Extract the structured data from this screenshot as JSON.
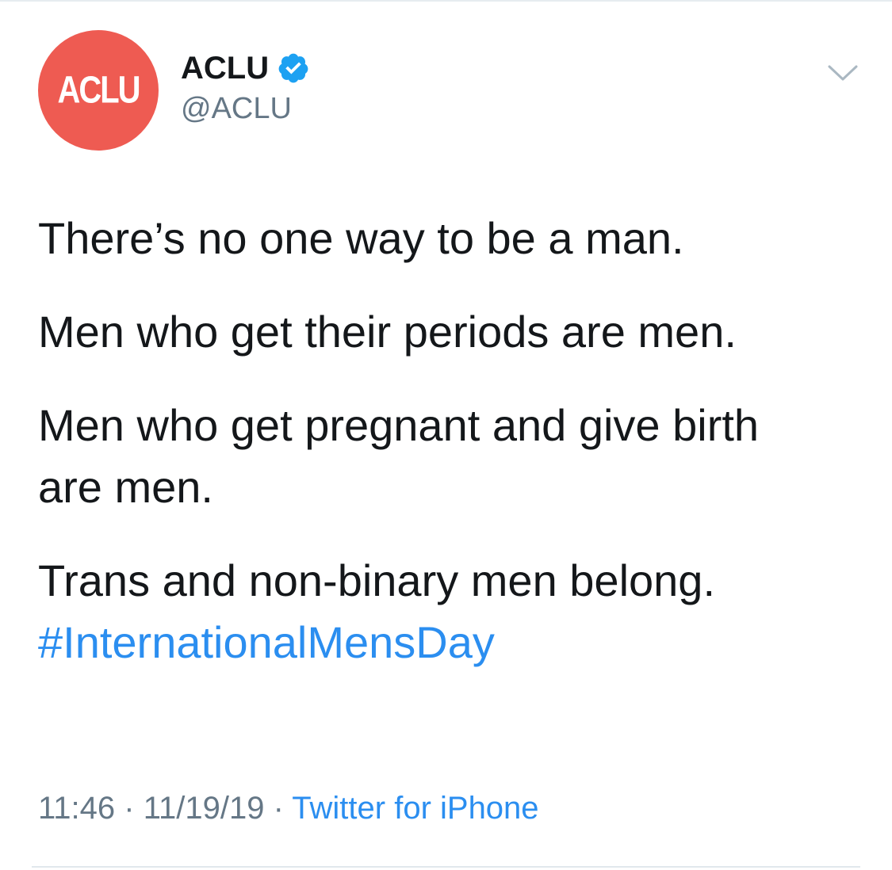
{
  "avatar": {
    "text": "ACLU",
    "color": "#ee5b52"
  },
  "user": {
    "display_name": "ACLU",
    "handle": "@ACLU",
    "verified": true,
    "verified_color": "#1da1f2"
  },
  "menu_icon": "chevron-down-icon",
  "tweet": {
    "lines": [
      "There’s no one way to be a man.",
      "Men who get their periods are men.",
      "Men who get pregnant and give birth",
      "are men.",
      "Trans and non-binary men belong."
    ],
    "hashtag": "#InternationalMensDay",
    "hashtag_color": "#2b8ef0"
  },
  "meta": {
    "time": "11:46",
    "separator": "·",
    "date": "11/19/19",
    "source": "Twitter for iPhone"
  }
}
